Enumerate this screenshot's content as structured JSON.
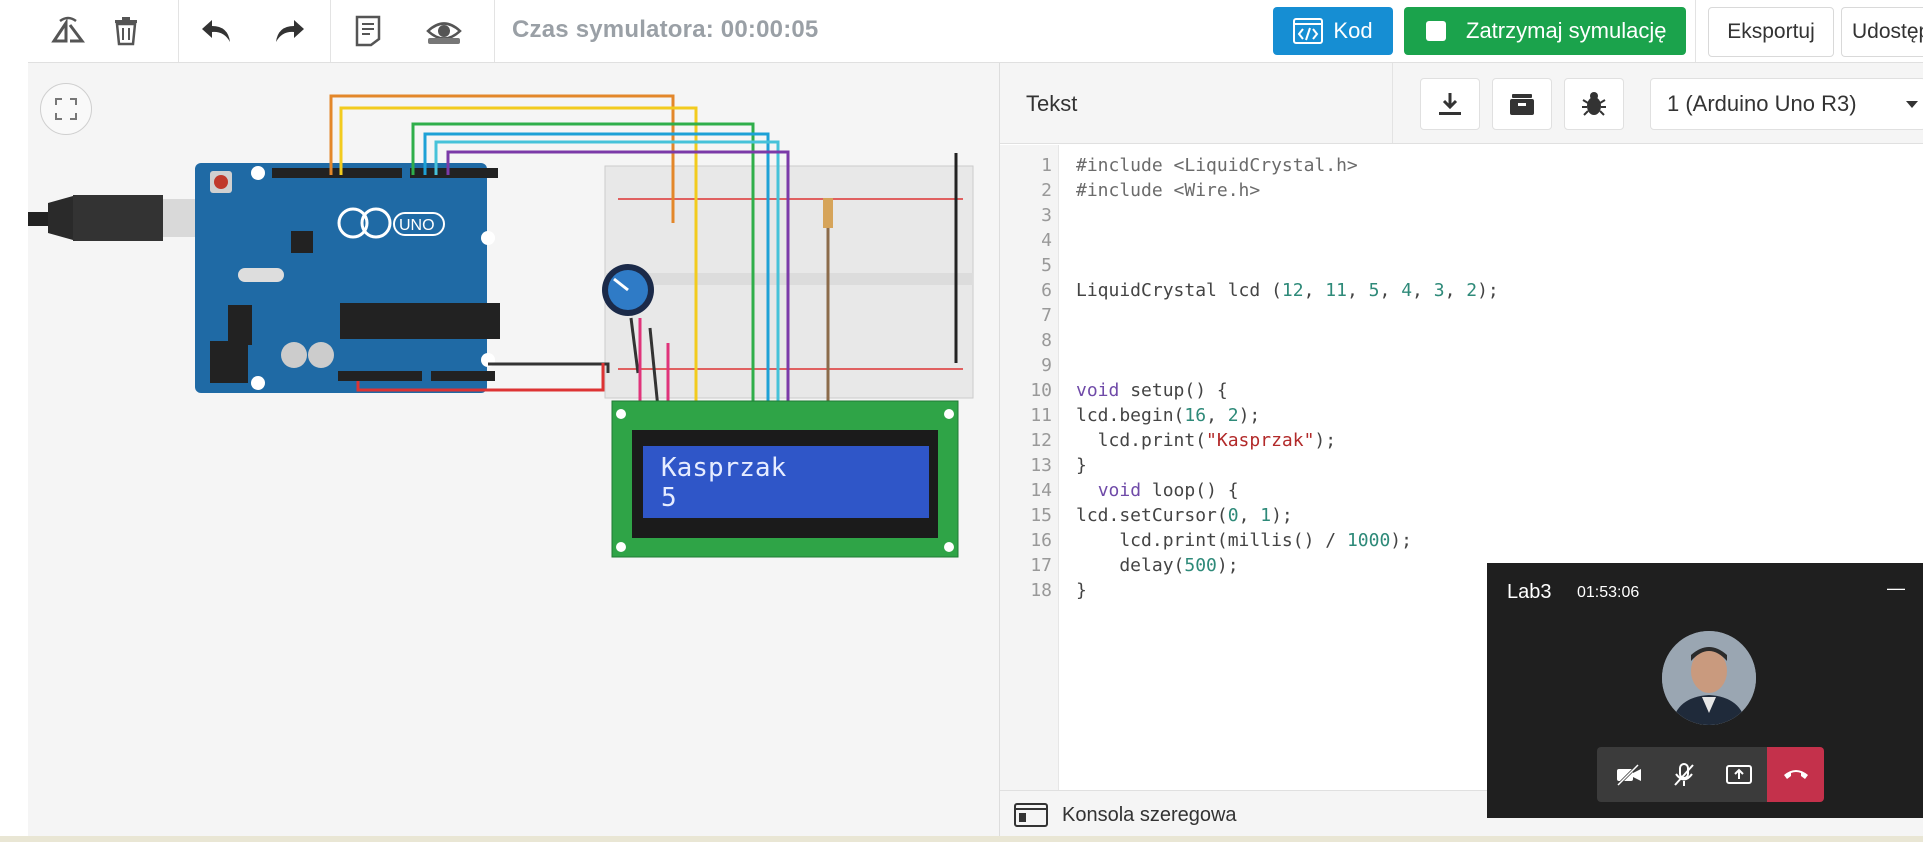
{
  "toolbar": {
    "sim_time": "Czas symulatora: 00:00:05",
    "code_label": "Kod",
    "stop_label": "Zatrzymaj symulację",
    "export_label": "Eksportuj",
    "share_label": "Udostępni",
    "icons": [
      "rotate-icon",
      "delete-icon",
      "undo-icon",
      "redo-icon",
      "notes-icon",
      "visibility-icon"
    ]
  },
  "circuit": {
    "lcd": {
      "line1": "Kasprzak",
      "line2": "5",
      "background": "#2f56c8"
    },
    "board_label": "UNO"
  },
  "code_panel": {
    "title": "Tekst",
    "device": "1 (Arduino Uno R3)",
    "lines": [
      {
        "no": "1",
        "text": "#include <LiquidCrystal.h>"
      },
      {
        "no": "2",
        "text": "#include <Wire.h>"
      },
      {
        "no": "3",
        "text": ""
      },
      {
        "no": "4",
        "text": ""
      },
      {
        "no": "5",
        "text": ""
      },
      {
        "no": "6",
        "text": "LiquidCrystal lcd (12, 11, 5, 4, 3, 2);"
      },
      {
        "no": "7",
        "text": ""
      },
      {
        "no": "8",
        "text": ""
      },
      {
        "no": "9",
        "text": ""
      },
      {
        "no": "10",
        "text": "void setup() {"
      },
      {
        "no": "11",
        "text": "lcd.begin(16, 2);"
      },
      {
        "no": "12",
        "text": "  lcd.print(\"Kasprzak\");"
      },
      {
        "no": "13",
        "text": "}"
      },
      {
        "no": "14",
        "text": "  void loop() {"
      },
      {
        "no": "15",
        "text": "lcd.setCursor(0, 1);"
      },
      {
        "no": "16",
        "text": "    lcd.print(millis() / 1000);"
      },
      {
        "no": "17",
        "text": "    delay(500);"
      },
      {
        "no": "18",
        "text": "}"
      }
    ],
    "console_label": "Konsola szeregowa"
  },
  "call": {
    "title": "Lab3",
    "timer": "01:53:06",
    "minimize": "—"
  },
  "colors": {
    "accent_blue": "#168ed3",
    "stop_green": "#1ba34c",
    "hang_red": "#c4314b"
  }
}
